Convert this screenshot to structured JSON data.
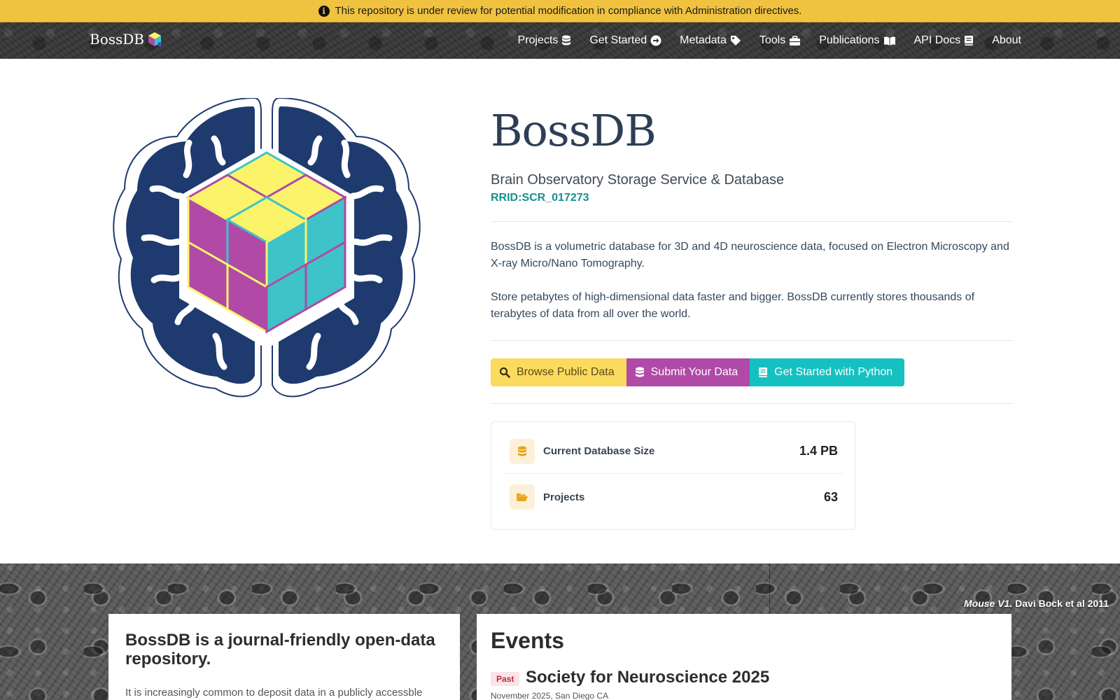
{
  "banner": {
    "text": "This repository is under review for potential modification in compliance with Administration directives.",
    "icon": "info-circle-icon"
  },
  "navbar": {
    "brand": "BossDB",
    "links": [
      {
        "label": "Projects",
        "icon": "database-icon"
      },
      {
        "label": "Get Started",
        "icon": "arrow-circle-right-icon"
      },
      {
        "label": "Metadata",
        "icon": "tag-icon"
      },
      {
        "label": "Tools",
        "icon": "toolbox-icon"
      },
      {
        "label": "Publications",
        "icon": "book-open-icon"
      },
      {
        "label": "API Docs",
        "icon": "book-icon"
      },
      {
        "label": "About",
        "icon": ""
      }
    ]
  },
  "hero": {
    "title": "BossDB",
    "subtitle": "Brain Observatory Storage Service & Database",
    "rrid": "RRID:SCR_017273",
    "description_1": "BossDB is a volumetric database for 3D and 4D neuroscience data, focused on Electron Microscopy and X-ray Micro/Nano Tomography.",
    "description_2": "Store petabytes of high-dimensional data faster and bigger. BossDB currently stores thousands of terabytes of data from all over the world."
  },
  "buttons": {
    "browse": "Browse Public Data",
    "submit": "Submit Your Data",
    "python": "Get Started with Python"
  },
  "stats": {
    "db_size_label": "Current Database Size",
    "db_size_value": "1.4 PB",
    "projects_label": "Projects",
    "projects_value": "63"
  },
  "image_credit": {
    "italic": "Mouse V1.",
    "rest": " Davi Bock et al 2011"
  },
  "journal_card": {
    "title": "BossDB is a journal-friendly open-data repository.",
    "text": "It is increasingly common to deposit data in a publicly accessble"
  },
  "events": {
    "heading": "Events",
    "items": [
      {
        "badge": "Past",
        "title": "Society for Neuroscience 2025",
        "meta": "November 2025, San Diego CA"
      }
    ]
  },
  "colors": {
    "banner": "#f1c23f",
    "navy": "#1e3a6e",
    "cube_yellow": "#fbf46a",
    "cube_magenta": "#b04aa6",
    "cube_teal": "#3ec3c9",
    "rrid": "#16918f",
    "btn_yellow": "#fbdb5e",
    "btn_magenta": "#b04aa6",
    "btn_teal": "#15c0c0"
  }
}
